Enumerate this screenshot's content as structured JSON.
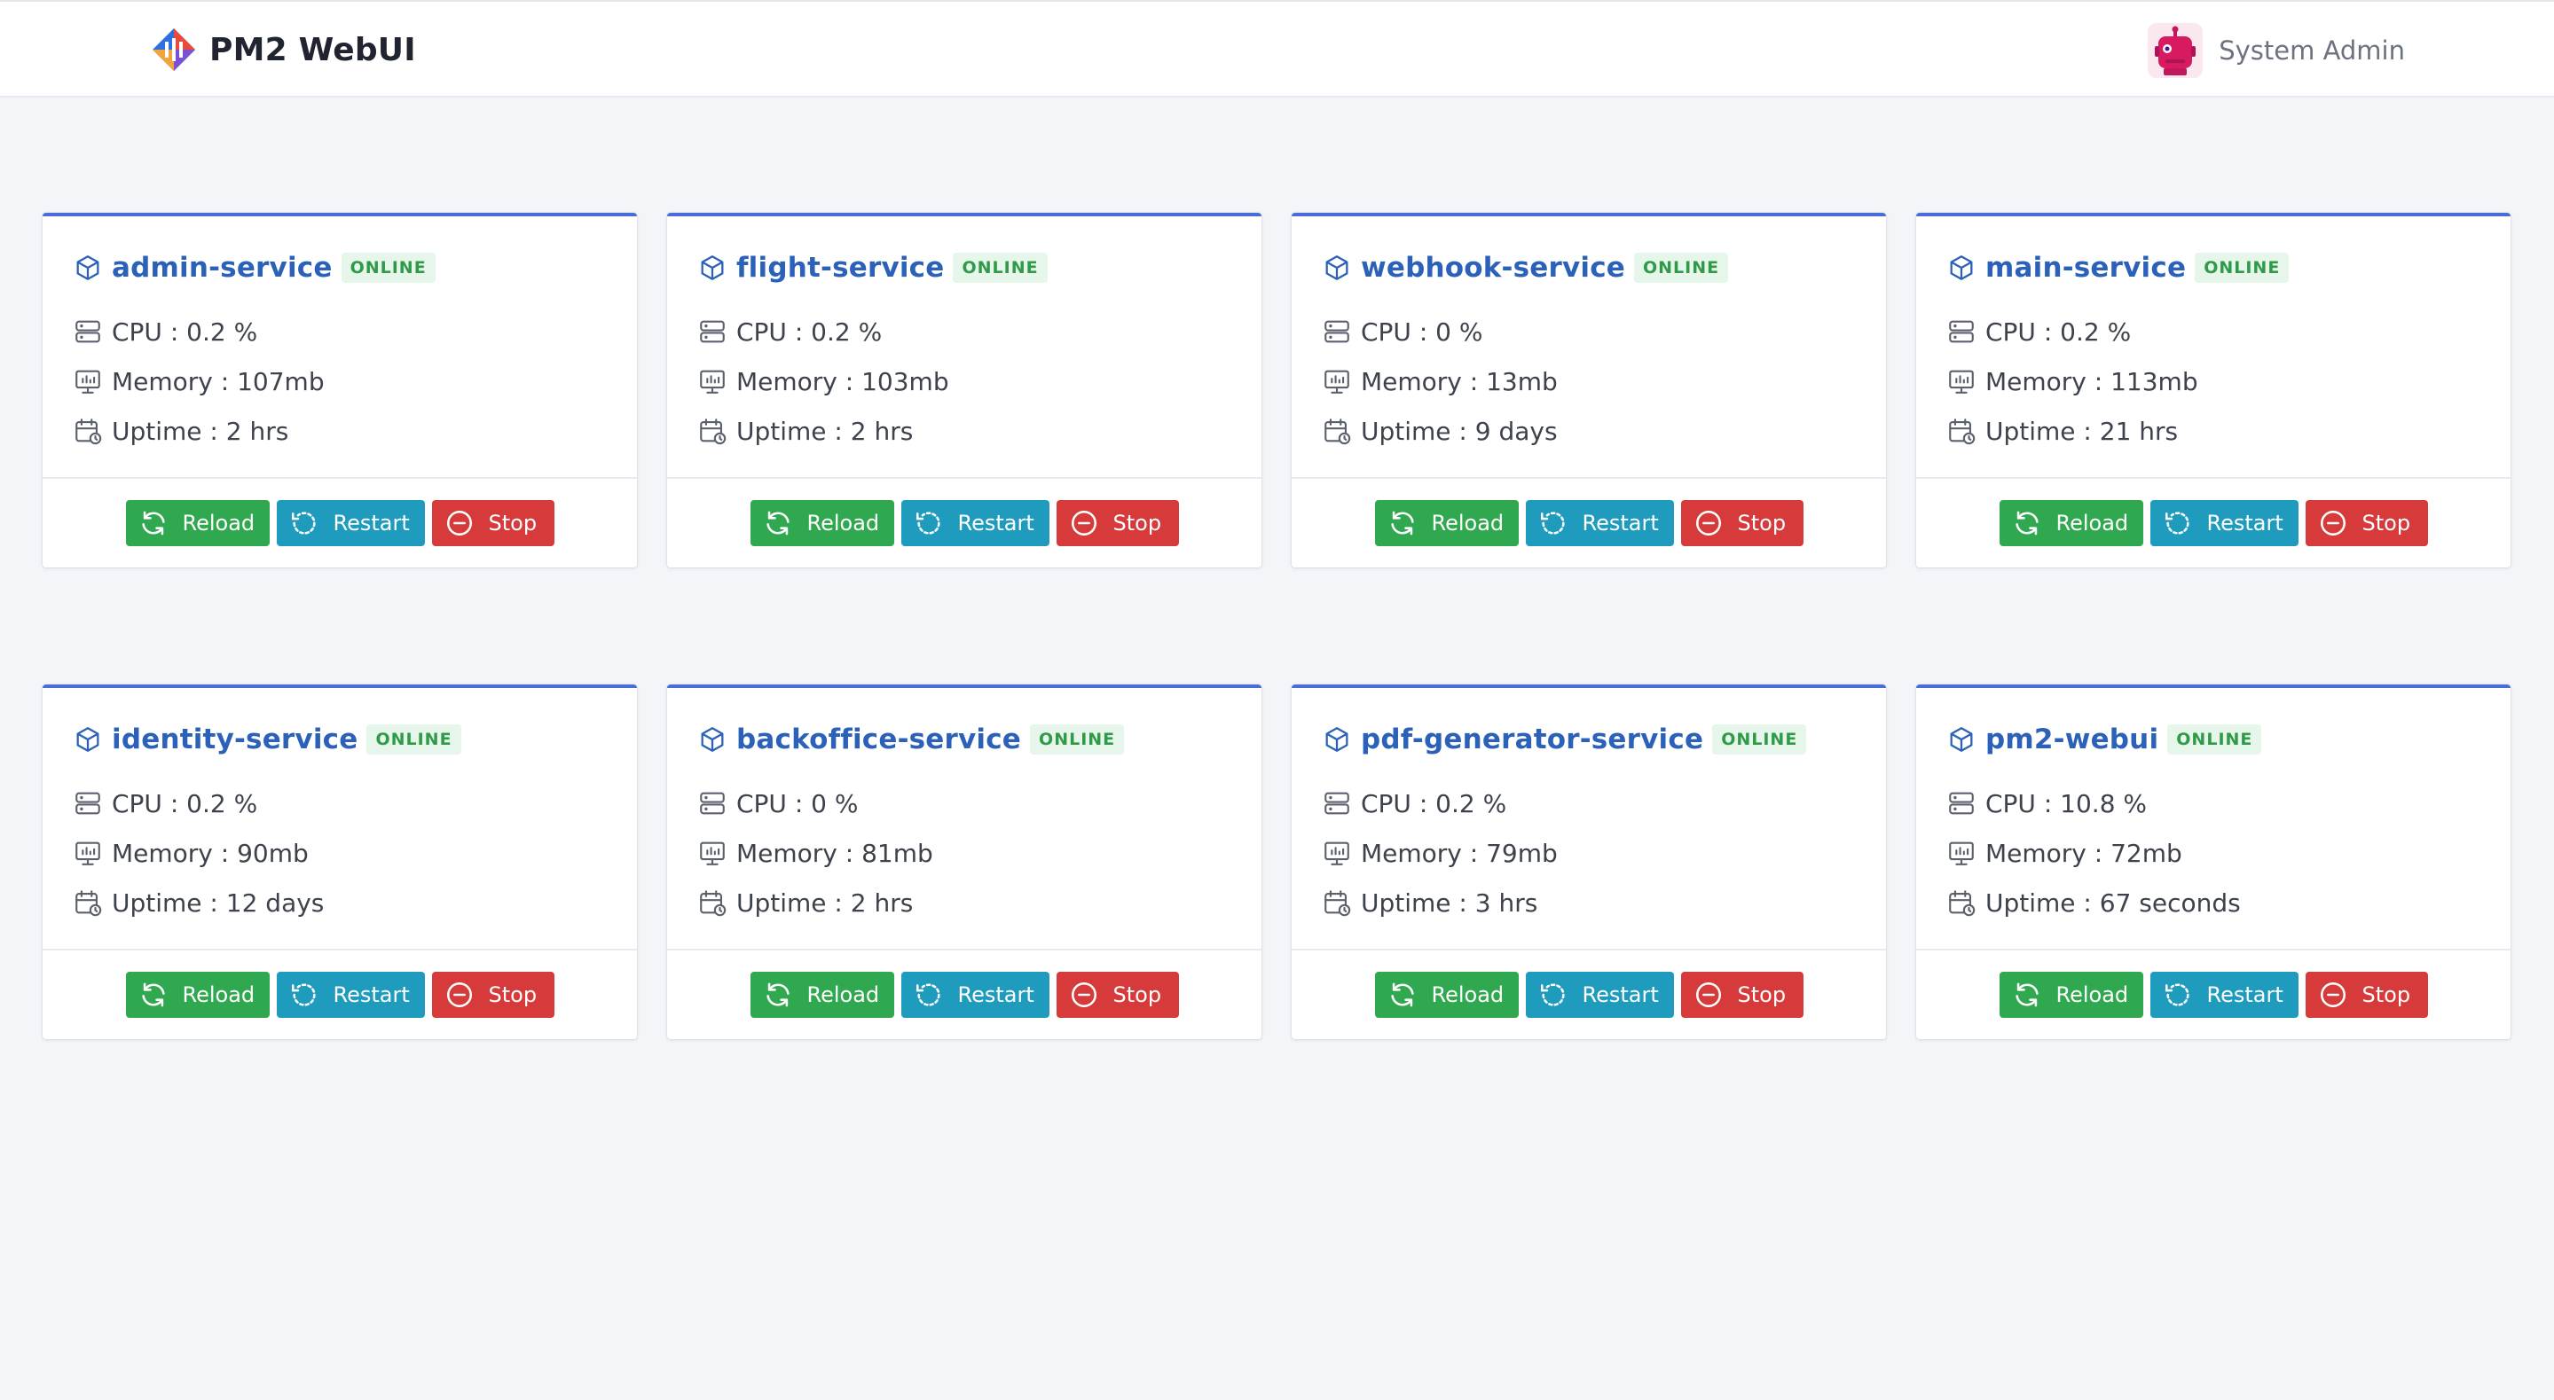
{
  "app": {
    "title": "PM2 WebUI",
    "logo_icon": "pm2-logo-icon"
  },
  "user": {
    "name": "System Admin",
    "avatar_icon": "robot-avatar-icon"
  },
  "colors": {
    "accent": "#4a6cd8",
    "service_name": "#2b61b8",
    "online_badge_bg": "#e7f6ea",
    "online_badge_text": "#2f9a48",
    "reload": "#2fa84f",
    "restart": "#1f9bbd",
    "stop": "#d63a3a"
  },
  "labels": {
    "cpu": "CPU : ",
    "memory": "Memory : ",
    "uptime": "Uptime : ",
    "reload": "Reload",
    "restart": "Restart",
    "stop": "Stop"
  },
  "services": [
    {
      "name": "admin-service",
      "status": "ONLINE",
      "cpu": "0.2 %",
      "memory": "107mb",
      "uptime": "2 hrs"
    },
    {
      "name": "flight-service",
      "status": "ONLINE",
      "cpu": "0.2 %",
      "memory": "103mb",
      "uptime": "2 hrs"
    },
    {
      "name": "webhook-service",
      "status": "ONLINE",
      "cpu": "0 %",
      "memory": "13mb",
      "uptime": "9 days"
    },
    {
      "name": "main-service",
      "status": "ONLINE",
      "cpu": "0.2 %",
      "memory": "113mb",
      "uptime": "21 hrs"
    },
    {
      "name": "identity-service",
      "status": "ONLINE",
      "cpu": "0.2 %",
      "memory": "90mb",
      "uptime": "12 days"
    },
    {
      "name": "backoffice-service",
      "status": "ONLINE",
      "cpu": "0 %",
      "memory": "81mb",
      "uptime": "2 hrs"
    },
    {
      "name": "pdf-generator-service",
      "status": "ONLINE",
      "cpu": "0.2 %",
      "memory": "79mb",
      "uptime": "3 hrs"
    },
    {
      "name": "pm2-webui",
      "status": "ONLINE",
      "cpu": "10.8 %",
      "memory": "72mb",
      "uptime": "67 seconds"
    }
  ]
}
